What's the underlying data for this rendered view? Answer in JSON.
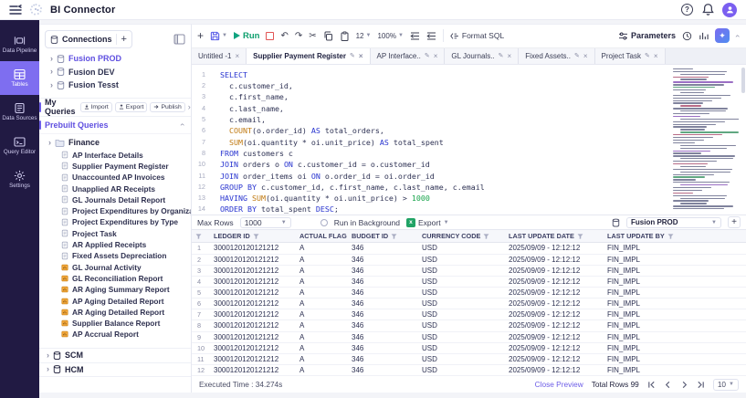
{
  "app": {
    "title": "BI Connector"
  },
  "nav": {
    "items": [
      {
        "label": "Data Pipeline",
        "icon": "data-pipeline-icon",
        "active": false
      },
      {
        "label": "Tables",
        "icon": "tables-icon",
        "active": true
      },
      {
        "label": "Data Sources",
        "icon": "data-sources-icon",
        "active": false
      },
      {
        "label": "Query Editor",
        "icon": "query-editor-icon",
        "active": false
      },
      {
        "label": "Settings",
        "icon": "settings-icon",
        "active": false
      }
    ]
  },
  "connections": {
    "title": "Connections",
    "items": [
      {
        "label": "Fusion PROD",
        "selected": true
      },
      {
        "label": "Fusion DEV",
        "selected": false
      },
      {
        "label": "Fusion Tesst",
        "selected": false
      }
    ]
  },
  "queries": {
    "my_label": "My Queries",
    "actions": [
      "Import",
      "Export",
      "Publish"
    ],
    "prebuilt_label": "Prebuilt Queries",
    "finance_label": "Finance",
    "finance_items": [
      {
        "label": "AP Interface Details",
        "icon": "doc"
      },
      {
        "label": "Supplier Payment Register",
        "icon": "doc"
      },
      {
        "label": "Unaccounted AP Invoices",
        "icon": "doc"
      },
      {
        "label": "Unapplied AR Receipts",
        "icon": "doc"
      },
      {
        "label": "GL Journals Detail Report",
        "icon": "doc"
      },
      {
        "label": "Project Expenditures by Organization",
        "icon": "doc"
      },
      {
        "label": "Project Expenditures by Type",
        "icon": "doc"
      },
      {
        "label": "Project Task",
        "icon": "doc"
      },
      {
        "label": "AR Applied Receipts",
        "icon": "doc"
      },
      {
        "label": "Fixed Assets Depreciation",
        "icon": "doc"
      },
      {
        "label": "GL Journal Activity",
        "icon": "report"
      },
      {
        "label": "GL Reconciliation Report",
        "icon": "report"
      },
      {
        "label": "AR Aging Summary Report",
        "icon": "report"
      },
      {
        "label": "AP Aging Detailed Report",
        "icon": "report"
      },
      {
        "label": "AR Aging Detailed Report",
        "icon": "report"
      },
      {
        "label": "Supplier Balance Report",
        "icon": "report"
      },
      {
        "label": "AP Accrual Report",
        "icon": "report"
      }
    ],
    "groups": [
      {
        "label": "SCM"
      },
      {
        "label": "HCM"
      }
    ]
  },
  "editor": {
    "toolbar": {
      "run": "Run",
      "font_size": "12",
      "zoom": "100%",
      "format": "Format SQL",
      "parameters": "Parameters"
    },
    "tabs": [
      {
        "label": "Untitled -1",
        "edit": false,
        "close": true,
        "active": false
      },
      {
        "label": "Supplier Payment Register",
        "edit": true,
        "close": true,
        "active": true
      },
      {
        "label": "AP Interface..",
        "edit": true,
        "close": true,
        "active": false
      },
      {
        "label": "GL Journals..",
        "edit": true,
        "close": true,
        "active": false
      },
      {
        "label": "Fixed Assets..",
        "edit": true,
        "close": true,
        "active": false
      },
      {
        "label": "Project Task",
        "edit": true,
        "close": true,
        "active": false
      }
    ],
    "code": [
      {
        "no": "1",
        "tokens": [
          [
            "SELECT",
            "k"
          ]
        ]
      },
      {
        "no": "2",
        "tokens": [
          [
            "  c.customer_id,",
            "t"
          ]
        ]
      },
      {
        "no": "3",
        "tokens": [
          [
            "  c.first_name,",
            "t"
          ]
        ]
      },
      {
        "no": "4",
        "tokens": [
          [
            "  c.last_name,",
            "t"
          ]
        ]
      },
      {
        "no": "5",
        "tokens": [
          [
            "  c.email,",
            "t"
          ]
        ]
      },
      {
        "no": "6",
        "tokens": [
          [
            "  ",
            "t"
          ],
          [
            "COUNT",
            "f"
          ],
          [
            "(o.order_id) ",
            "t"
          ],
          [
            "AS",
            "k"
          ],
          [
            " total_orders,",
            "t"
          ]
        ]
      },
      {
        "no": "7",
        "tokens": [
          [
            "  ",
            "t"
          ],
          [
            "SUM",
            "f"
          ],
          [
            "(oi.quantity * oi.unit_price) ",
            "t"
          ],
          [
            "AS",
            "k"
          ],
          [
            " total_spent",
            "t"
          ]
        ]
      },
      {
        "no": "8",
        "tokens": [
          [
            "FROM",
            "k"
          ],
          [
            " customers c",
            "t"
          ]
        ]
      },
      {
        "no": "10",
        "tokens": [
          [
            "JOIN",
            "k"
          ],
          [
            " orders o ",
            "t"
          ],
          [
            "ON",
            "k"
          ],
          [
            " c.customer_id = o.customer_id",
            "t"
          ]
        ]
      },
      {
        "no": "11",
        "tokens": [
          [
            "JOIN",
            "k"
          ],
          [
            " order_items oi ",
            "t"
          ],
          [
            "ON",
            "k"
          ],
          [
            " o.order_id = oi.order_id",
            "t"
          ]
        ]
      },
      {
        "no": "12",
        "tokens": [
          [
            "GROUP BY",
            "k"
          ],
          [
            " c.customer_id, c.first_name, c.last_name, c.email",
            "t"
          ]
        ]
      },
      {
        "no": "13",
        "tokens": [
          [
            "HAVING",
            "k"
          ],
          [
            " ",
            "t"
          ],
          [
            "SUM",
            "f"
          ],
          [
            "(oi.quantity * oi.unit_price) > ",
            "t"
          ],
          [
            "1000",
            "n"
          ]
        ]
      },
      {
        "no": "14",
        "tokens": [
          [
            "ORDER BY",
            "k"
          ],
          [
            " total_spent ",
            "t"
          ],
          [
            "DESC",
            "k"
          ],
          [
            ";",
            "t"
          ]
        ]
      }
    ]
  },
  "results": {
    "max_rows_label": "Max Rows",
    "max_rows_value": "1000",
    "run_bg_label": "Run in Background",
    "export_label": "Export",
    "connection_value": "Fusion PROD",
    "columns": [
      "LEDGER ID",
      "ACTUAL FLAG",
      "BUDGET ID",
      "CURRENCY CODE",
      "LAST UPDATE DATE",
      "LAST UPDATE BY"
    ],
    "rows": [
      [
        "3000120120121212",
        "A",
        "346",
        "USD",
        "2025/09/09 - 12:12:12",
        "FIN_IMPL"
      ],
      [
        "3000120120121212",
        "A",
        "346",
        "USD",
        "2025/09/09 - 12:12:12",
        "FIN_IMPL"
      ],
      [
        "3000120120121212",
        "A",
        "346",
        "USD",
        "2025/09/09 - 12:12:12",
        "FIN_IMPL"
      ],
      [
        "3000120120121212",
        "A",
        "346",
        "USD",
        "2025/09/09 - 12:12:12",
        "FIN_IMPL"
      ],
      [
        "3000120120121212",
        "A",
        "346",
        "USD",
        "2025/09/09 - 12:12:12",
        "FIN_IMPL"
      ],
      [
        "3000120120121212",
        "A",
        "346",
        "USD",
        "2025/09/09 - 12:12:12",
        "FIN_IMPL"
      ],
      [
        "3000120120121212",
        "A",
        "346",
        "USD",
        "2025/09/09 - 12:12:12",
        "FIN_IMPL"
      ],
      [
        "3000120120121212",
        "A",
        "346",
        "USD",
        "2025/09/09 - 12:12:12",
        "FIN_IMPL"
      ],
      [
        "3000120120121212",
        "A",
        "346",
        "USD",
        "2025/09/09 - 12:12:12",
        "FIN_IMPL"
      ],
      [
        "3000120120121212",
        "A",
        "346",
        "USD",
        "2025/09/09 - 12:12:12",
        "FIN_IMPL"
      ],
      [
        "3000120120121212",
        "A",
        "346",
        "USD",
        "2025/09/09 - 12:12:12",
        "FIN_IMPL"
      ],
      [
        "3000120120121212",
        "A",
        "346",
        "USD",
        "2025/09/09 - 12:12:12",
        "FIN_IMPL"
      ]
    ],
    "footer": {
      "executed": "Executed Time : 34.274s",
      "close_preview": "Close Preview",
      "total_rows": "Total Rows 99",
      "page_size": "10"
    }
  },
  "colors": {
    "accent_purple": "#6c5ce7",
    "nav_bg": "#211a43",
    "nav_active": "#7e6ef0",
    "run_green": "#0e9f6e",
    "stop_red": "#e25555",
    "keyword_blue": "#2733cf",
    "function_orange": "#c07a12",
    "number_green": "#16a34a",
    "report_icon_orange": "#f3a83b"
  }
}
